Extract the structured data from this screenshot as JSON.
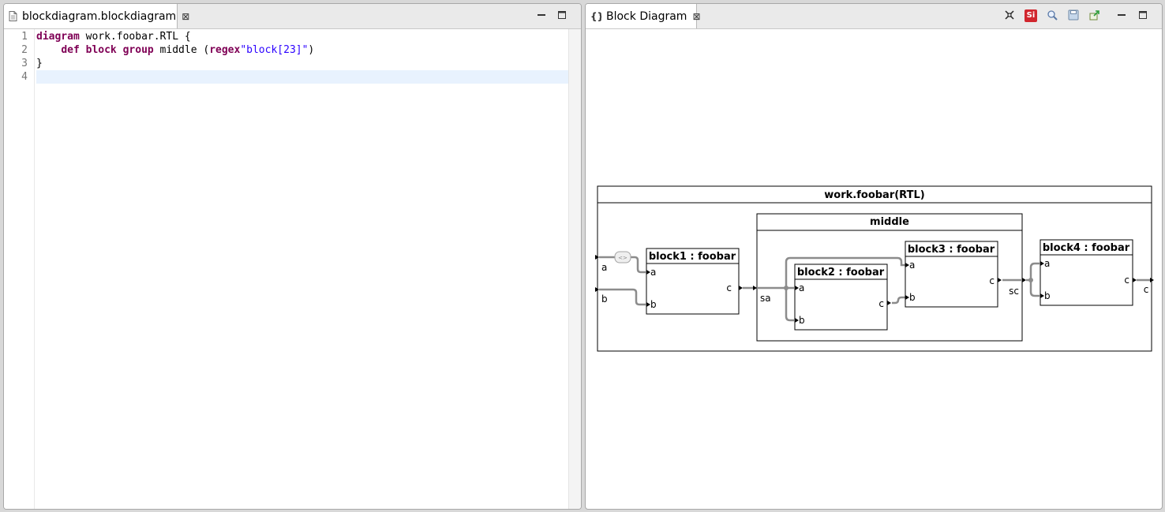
{
  "left_panel": {
    "tab": {
      "label": "blockdiagram.blockdiagram",
      "close": "⊠",
      "icon": "file-icon"
    },
    "line_numbers": [
      "1",
      "2",
      "3",
      "4"
    ],
    "code": {
      "line1": {
        "kw": "diagram",
        "rest": " work.foobar.RTL {"
      },
      "line2": {
        "indent": "    ",
        "kw1": "def",
        "sp1": " ",
        "kw2": "block",
        "sp2": " ",
        "kw3": "group",
        "mid": " middle (",
        "kw4": "regex",
        "str": "\"block[23]\"",
        "end": ")"
      },
      "line3": {
        "text": "}"
      },
      "line4": {
        "text": ""
      }
    },
    "window_buttons": [
      "minimize-icon",
      "maximize-icon"
    ]
  },
  "right_panel": {
    "tab": {
      "label": "Block Diagram",
      "close": "⊠",
      "icon": "braces-icon"
    },
    "toolbar_icons": [
      "fit-icon",
      "sirius-icon",
      "zoom-icon",
      "save-icon",
      "export-icon"
    ],
    "window_buttons": [
      "minimize-icon",
      "maximize-icon"
    ],
    "toolbar_sirius_label": "Si"
  },
  "diagram": {
    "title": "work.foobar(RTL)",
    "inputs": {
      "a": "a",
      "b": "b"
    },
    "output": "c",
    "inverter_label": "<>",
    "block1": {
      "title": "block1 : foobar",
      "in_a": "a",
      "in_b": "b",
      "out": "c"
    },
    "group": {
      "title": "middle",
      "input": "sa",
      "output": "sc",
      "block2": {
        "title": "block2 : foobar",
        "in_a": "a",
        "in_b": "b",
        "out": "c"
      },
      "block3": {
        "title": "block3 : foobar",
        "in_a": "a",
        "in_b": "b",
        "out": "c"
      }
    },
    "block4": {
      "title": "block4 : foobar",
      "in_a": "a",
      "in_b": "b",
      "out": "c"
    }
  },
  "colors": {
    "keyword": "#7f0055",
    "string": "#2a00ff",
    "current_line": "#e8f2fe",
    "wire": "#8c8c8c"
  }
}
